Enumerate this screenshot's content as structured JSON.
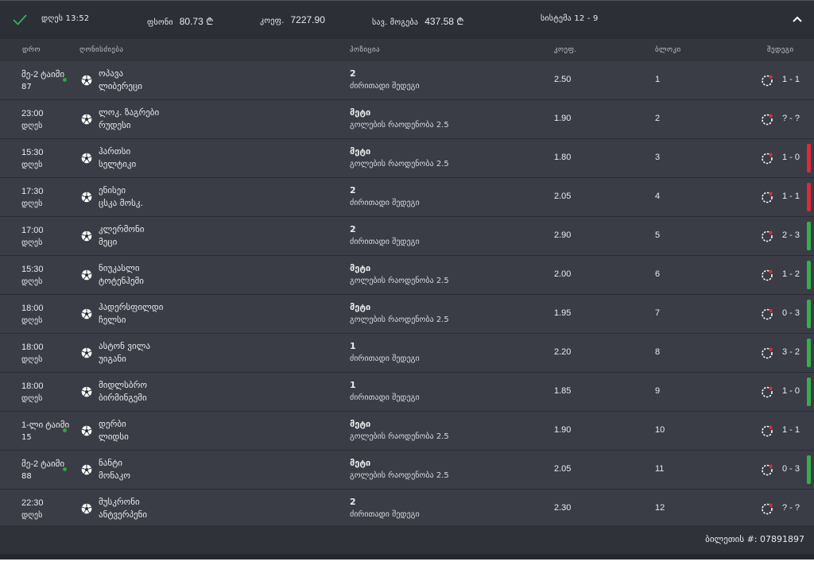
{
  "header": {
    "date_label": "დღეს 13:52",
    "stake_label": "ფსონი",
    "stake_value": "80.73 ₾",
    "coef_label": "კოეფ.",
    "coef_value": "7227.90",
    "potential_label": "სავ. მოგება",
    "potential_value": "437.58 ₾",
    "system_label": "სისტემა 12 - 9",
    "colors": {
      "check": "#2fb55a",
      "win": "#35b04a",
      "loss": "#e0283c"
    }
  },
  "columns": {
    "time": "დრო",
    "event": "ღონისძიება",
    "position": "პოზიცია",
    "coef": "კოეფ.",
    "block": "ბლოკი",
    "result": "შედეგი"
  },
  "rows": [
    {
      "time1": "მე-2 ტაიმი",
      "time2": "87",
      "live": true,
      "team1": "ოპავა",
      "team2": "ლიბერეცი",
      "pick": "2",
      "market": "ძირითადი შედეგი",
      "coef": "2.50",
      "block": "1",
      "score": "1 - 1",
      "status": ""
    },
    {
      "time1": "23:00",
      "time2": "დღეს",
      "live": false,
      "team1": "ლოკ. ზაგრები",
      "team2": "რუდესი",
      "pick": "მეტი",
      "market": "გოლების რაოდენობა 2.5",
      "coef": "1.90",
      "block": "2",
      "score": "? - ?",
      "status": ""
    },
    {
      "time1": "15:30",
      "time2": "დღეს",
      "live": false,
      "team1": "ჰართსი",
      "team2": "სელტიკი",
      "pick": "მეტი",
      "market": "გოლების რაოდენობა 2.5",
      "coef": "1.80",
      "block": "3",
      "score": "1 - 0",
      "status": "loss"
    },
    {
      "time1": "17:30",
      "time2": "დღეს",
      "live": false,
      "team1": "ენისეი",
      "team2": "ცსკა მოსკ.",
      "pick": "2",
      "market": "ძირითადი შედეგი",
      "coef": "2.05",
      "block": "4",
      "score": "1 - 1",
      "status": "loss"
    },
    {
      "time1": "17:00",
      "time2": "დღეს",
      "live": false,
      "team1": "კლერმონი",
      "team2": "მეცი",
      "pick": "2",
      "market": "ძირითადი შედეგი",
      "coef": "2.90",
      "block": "5",
      "score": "2 - 3",
      "status": "win"
    },
    {
      "time1": "15:30",
      "time2": "დღეს",
      "live": false,
      "team1": "ნიუკასლი",
      "team2": "ტოტენჰემი",
      "pick": "მეტი",
      "market": "გოლების რაოდენობა 2.5",
      "coef": "2.00",
      "block": "6",
      "score": "1 - 2",
      "status": "win"
    },
    {
      "time1": "18:00",
      "time2": "დღეს",
      "live": false,
      "team1": "ჰადერსფილდი",
      "team2": "ჩელსი",
      "pick": "მეტი",
      "market": "გოლების რაოდენობა 2.5",
      "coef": "1.95",
      "block": "7",
      "score": "0 - 3",
      "status": "win"
    },
    {
      "time1": "18:00",
      "time2": "დღეს",
      "live": false,
      "team1": "ასტონ ვილა",
      "team2": "უიგანი",
      "pick": "1",
      "market": "ძირითადი შედეგი",
      "coef": "2.20",
      "block": "8",
      "score": "3 - 2",
      "status": "win"
    },
    {
      "time1": "18:00",
      "time2": "დღეს",
      "live": false,
      "team1": "მიდლსბრო",
      "team2": "ბირმინგემი",
      "pick": "1",
      "market": "ძირითადი შედეგი",
      "coef": "1.85",
      "block": "9",
      "score": "1 - 0",
      "status": "win"
    },
    {
      "time1": "1-ლი ტაიმი",
      "time2": "15",
      "live": true,
      "team1": "დერბი",
      "team2": "ლიდსი",
      "pick": "მეტი",
      "market": "გოლების რაოდენობა 2.5",
      "coef": "1.90",
      "block": "10",
      "score": "1 - 1",
      "status": ""
    },
    {
      "time1": "მე-2 ტაიმი",
      "time2": "88",
      "live": true,
      "team1": "ნანტი",
      "team2": "მონაკო",
      "pick": "მეტი",
      "market": "გოლების რაოდენობა 2.5",
      "coef": "2.05",
      "block": "11",
      "score": "0 - 3",
      "status": "win"
    },
    {
      "time1": "22:30",
      "time2": "დღეს",
      "live": false,
      "team1": "მუსკრონი",
      "team2": "ანტვერპენი",
      "pick": "2",
      "market": "ძირითადი შედეგი",
      "coef": "2.30",
      "block": "12",
      "score": "? - ?",
      "status": ""
    }
  ],
  "footer": {
    "ticket": "ბილეთის #: 07891897"
  }
}
